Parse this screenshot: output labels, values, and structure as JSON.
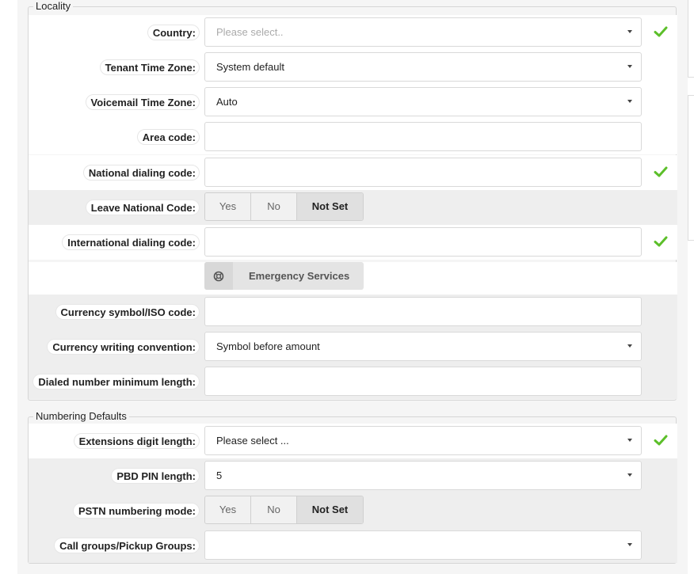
{
  "locality": {
    "legend": "Locality",
    "country": {
      "label": "Country:",
      "placeholder": "Please select.."
    },
    "tenant_time_zone": {
      "label": "Tenant Time Zone:",
      "value": "System default"
    },
    "voicemail_time_zone": {
      "label": "Voicemail Time Zone:",
      "value": "Auto"
    },
    "area_code": {
      "label": "Area code:",
      "value": ""
    },
    "national_dialing_code": {
      "label": "National dialing code:",
      "value": ""
    },
    "leave_national_code": {
      "label": "Leave National Code:",
      "options": [
        "Yes",
        "No",
        "Not Set"
      ],
      "selected": "Not Set"
    },
    "international_dialing_code": {
      "label": "International dialing code:",
      "value": ""
    },
    "emergency_services": {
      "label": "Emergency Services",
      "icon": "lifebuoy-icon"
    },
    "currency_symbol": {
      "label": "Currency symbol/ISO code:",
      "value": ""
    },
    "currency_convention": {
      "label": "Currency writing convention:",
      "value": "Symbol before amount"
    },
    "dialed_min_length": {
      "label": "Dialed number minimum length:",
      "value": ""
    }
  },
  "numbering": {
    "legend": "Numbering Defaults",
    "extensions_digit_length": {
      "label": "Extensions digit length:",
      "value": "Please select ..."
    },
    "pbd_pin_length": {
      "label": "PBD PIN length:",
      "value": "5"
    },
    "pstn_numbering_mode": {
      "label": "PSTN numbering mode:",
      "options": [
        "Yes",
        "No",
        "Not Set"
      ],
      "selected": "Not Set"
    },
    "call_groups": {
      "label": "Call groups/Pickup Groups:",
      "value": ""
    }
  },
  "colors": {
    "check": "#5cbf2a",
    "panel_bg": "#f5f5f5",
    "active_segment": "#e0e0e0"
  }
}
